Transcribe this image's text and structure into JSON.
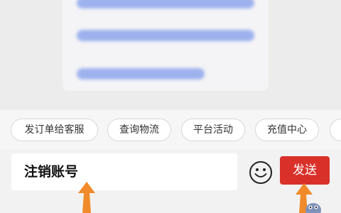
{
  "quick_replies": [
    "发订单给客服",
    "查询物流",
    "平台活动",
    "充值中心",
    ""
  ],
  "input": {
    "value": "注销账号"
  },
  "send_button": {
    "label": "发送"
  },
  "icons": {
    "emoji": "smiley-face-icon",
    "annotation_arrow": "orange-arrow-icon"
  },
  "colors": {
    "send_button": "#d9302a",
    "annotation_arrow": "#f08a2a",
    "chip_border": "#d8d8d8"
  }
}
